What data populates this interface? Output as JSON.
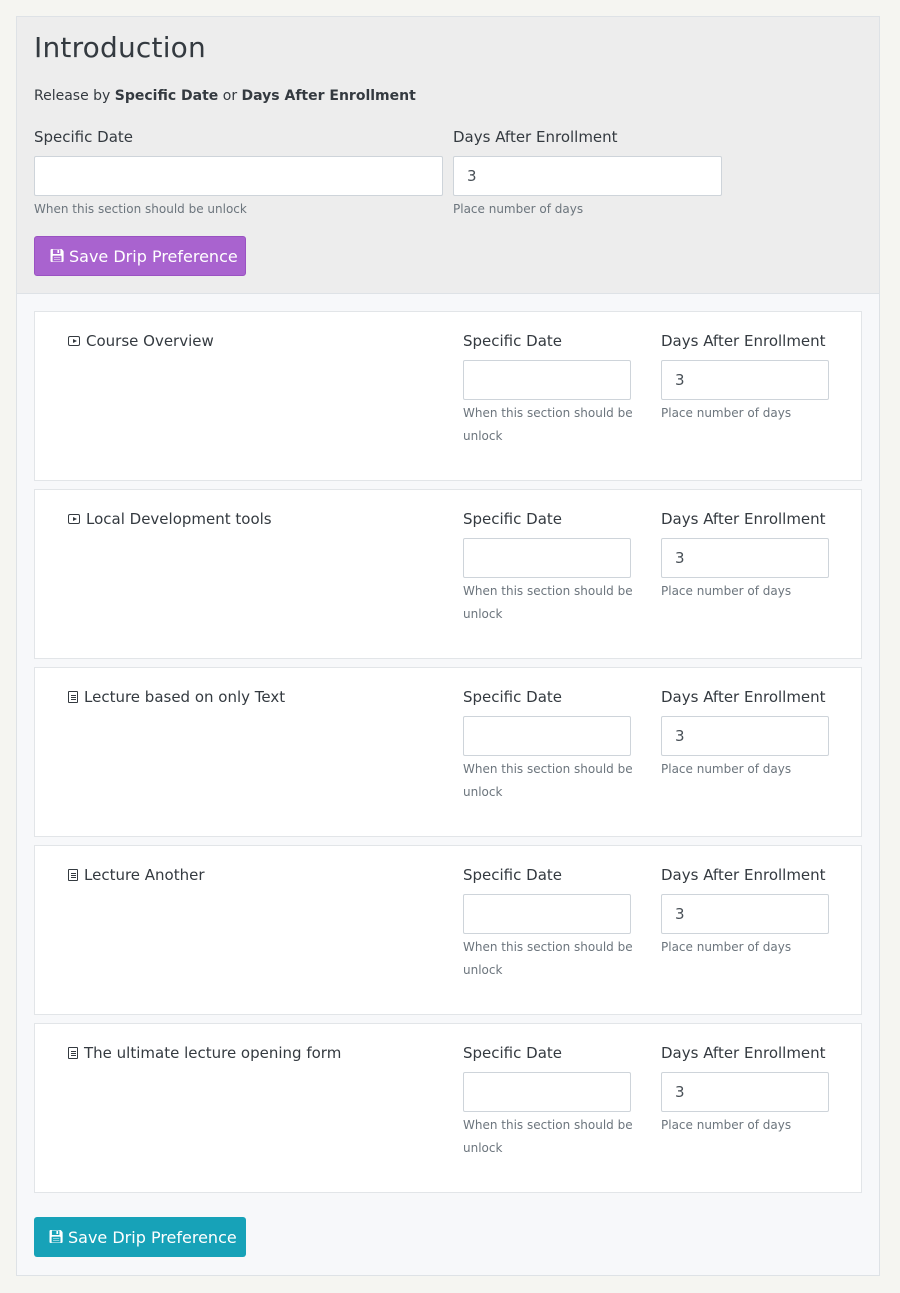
{
  "section": {
    "title": "Introduction",
    "subtitle_prefix": "Release by ",
    "subtitle_bold1": "Specific Date",
    "subtitle_mid": " or ",
    "subtitle_bold2": "Days After Enrollment",
    "specific_date_label": "Specific Date",
    "specific_date_value": "",
    "specific_date_help": "When this section should be unlock",
    "days_label": "Days After Enrollment",
    "days_value": "3",
    "days_help": "Place number of days",
    "save_button": "Save Drip Preference",
    "save_icon": "floppy-disk-icon",
    "save_button_color": "#a963cf"
  },
  "lessons": [
    {
      "title": "Course Overview",
      "icon": "video-icon",
      "specific_date_label": "Specific Date",
      "specific_date_value": "",
      "specific_date_help": "When this section should be unlock",
      "days_label": "Days After Enrollment",
      "days_value": "3",
      "days_help": "Place number of days"
    },
    {
      "title": "Local Development tools",
      "icon": "video-icon",
      "specific_date_label": "Specific Date",
      "specific_date_value": "",
      "specific_date_help": "When this section should be unlock",
      "days_label": "Days After Enrollment",
      "days_value": "3",
      "days_help": "Place number of days"
    },
    {
      "title": "Lecture based on only Text",
      "icon": "document-icon",
      "specific_date_label": "Specific Date",
      "specific_date_value": "",
      "specific_date_help": "When this section should be unlock",
      "days_label": "Days After Enrollment",
      "days_value": "3",
      "days_help": "Place number of days"
    },
    {
      "title": "Lecture Another",
      "icon": "document-icon",
      "specific_date_label": "Specific Date",
      "specific_date_value": "",
      "specific_date_help": "When this section should be unlock",
      "days_label": "Days After Enrollment",
      "days_value": "3",
      "days_help": "Place number of days"
    },
    {
      "title": "The ultimate lecture opening form",
      "icon": "document-icon",
      "specific_date_label": "Specific Date",
      "specific_date_value": "",
      "specific_date_help": "When this section should be unlock",
      "days_label": "Days After Enrollment",
      "days_value": "3",
      "days_help": "Place number of days"
    }
  ],
  "footer": {
    "save_button": "Save Drip Preference",
    "save_icon": "floppy-disk-icon",
    "save_button_color": "#17a2b8"
  }
}
